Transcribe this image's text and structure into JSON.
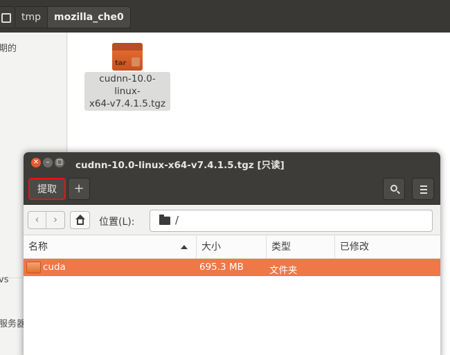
{
  "bg": {
    "path": [
      "tmp",
      "mozilla_che0"
    ],
    "sidebar_texts": [
      "期的",
      "vs",
      "服务器"
    ],
    "file": {
      "name_line1": "cudnn-10.0-linux-",
      "name_line2": "x64-v7.4.1.5.tgz",
      "icon_label": "tar"
    }
  },
  "window": {
    "title": "cudnn-10.0-linux-x64-v7.4.1.5.tgz [只读]",
    "toolbar": {
      "extract_label": "提取",
      "add_label": "+"
    },
    "location": {
      "label": "位置(L):",
      "value": "/"
    },
    "columns": {
      "name": "名称",
      "size": "大小",
      "type": "类型",
      "modified": "已修改"
    },
    "rows": [
      {
        "name": "cuda",
        "size": "695.3 MB",
        "type": "文件夹",
        "modified": ""
      }
    ]
  },
  "colors": {
    "accent": "#f07746",
    "close": "#e65a2e",
    "highlight": "#e0161b",
    "titlebar": "#3d3c38"
  },
  "icons": [
    "home-icon",
    "search-icon",
    "hamburger-menu-icon",
    "folder-icon",
    "tar-archive-icon",
    "chevron-left-icon",
    "chevron-right-icon",
    "lock-icon",
    "sort-ascending-icon"
  ]
}
